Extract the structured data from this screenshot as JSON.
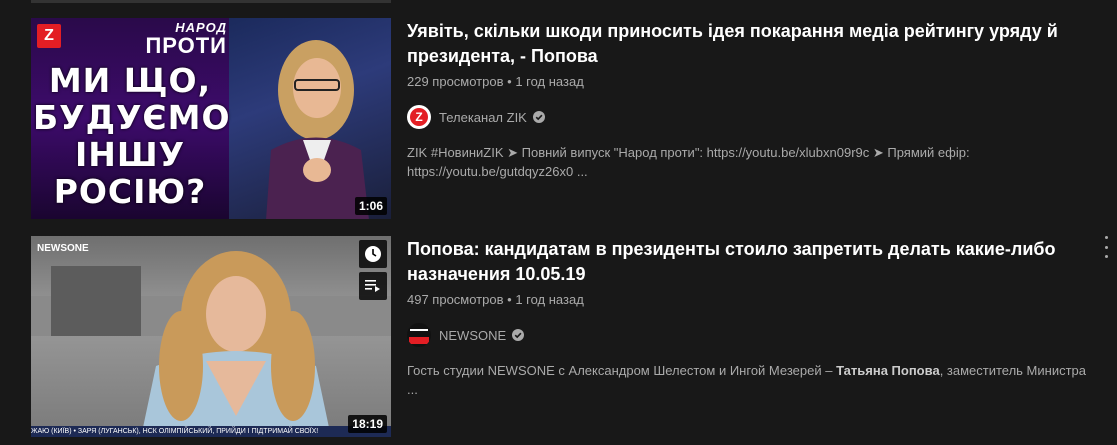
{
  "videos": [
    {
      "title": "Уявіть, скільки шкоди приносить ідея покарання медіа рейтингу уряду й президента, - Попова",
      "views": "229 просмотров",
      "age": "1 год назад",
      "channel": "Телеканал ZIK",
      "verified": true,
      "description": "ZIK #НовиниZIK ➤ Повний випуск \"Народ проти\": https://youtu.be/xlubxn09r9c ➤ Прямий ефір: https://youtu.be/gutdqyz26x0 ...",
      "duration": "1:06",
      "thumb_text": "МИ ЩО, БУДУЄМО ІНШУ РОСІЮ?",
      "thumb_show_top": "НАРОД",
      "thumb_show_bottom": "ПРОТИ"
    },
    {
      "title": "Попова: кандидатам в президенты стоило запретить делать какие-либо назначения 10.05.19",
      "views": "497 просмотров",
      "age": "1 год назад",
      "channel": "NEWSONE",
      "verified": true,
      "description_pre": "Гость студии NEWSONE с Александром Шелестом и Ингой Мезерей – ",
      "description_bold": "Татьяна Попова",
      "description_post": ", заместитель Министра ...",
      "duration": "18:19",
      "thumb_logo": "NEWSONE",
      "thumb_ticker": "ЖАЮ (КИЇВ) • ЗАРЯ (ЛУГАНСЬК), НСК ОЛІМПІЙСЬКИЙ, ПРИЙДИ І ПІДТРИМАЙ СВОЇХ!"
    }
  ],
  "colors": {
    "background": "#181818",
    "title": "#ffffff",
    "meta": "#aaaaaa",
    "zik_red": "#e31e24"
  }
}
